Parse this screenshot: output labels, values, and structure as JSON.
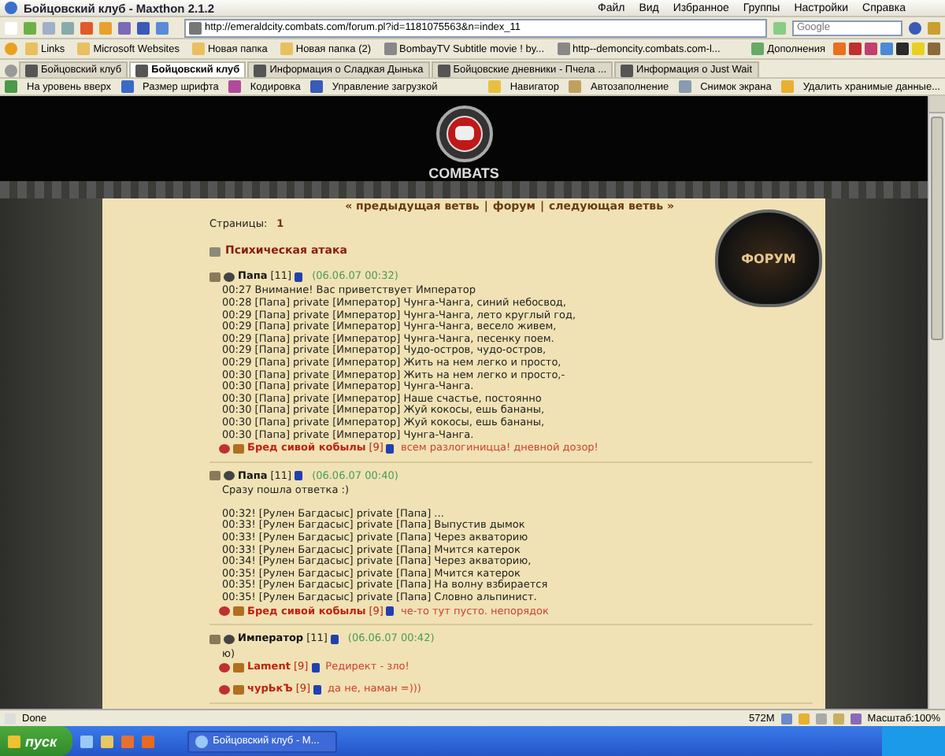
{
  "window": {
    "title": "Бойцовский клуб - Maxthon 2.1.2",
    "menu": [
      "Файл",
      "Вид",
      "Избранное",
      "Группы",
      "Настройки",
      "Справка"
    ]
  },
  "address_bar": {
    "url": "http://emeraldcity.combats.com/forum.pl?id=1181075563&n=index_11"
  },
  "search": {
    "placeholder": "Google"
  },
  "links_bar": [
    "Links",
    "Microsoft Websites",
    "Новая папка",
    "Новая папка (2)",
    "BombayTV  Subtitle movie !  by...",
    "http--demoncity.combats.com-l..."
  ],
  "plugins_button": "Дополнения",
  "tabs": [
    {
      "label": "Бойцовский клуб",
      "selected": false
    },
    {
      "label": "Бойцовский клуб",
      "selected": true
    },
    {
      "label": "Информация о Сладкая Дынька",
      "selected": false
    },
    {
      "label": "Бойцовские дневники - Пчела ...",
      "selected": false
    },
    {
      "label": "Информация о Just Wait",
      "selected": false
    }
  ],
  "tool_bar": {
    "left": [
      "На уровень вверх",
      "Размер шрифта",
      "Кодировка",
      "Управление загрузкой"
    ],
    "right": [
      "Навигатор",
      "Автозаполнение",
      "Снимок экрана",
      "Удалить хранимые данные..."
    ]
  },
  "page": {
    "logo_text": "COMBATS",
    "badge": "ФОРУМ",
    "nav": [
      "« предыдущая ветвь",
      "форум",
      "следующая ветвь »"
    ],
    "nav_separators": [
      "|",
      "|"
    ],
    "pages_label": "Страницы:",
    "pages": [
      "1"
    ],
    "thread_title": "Психическая атака",
    "posts": [
      {
        "author": "Папа",
        "rank": "[11]",
        "date": "(06.06.07 00:32)",
        "lines": [
          "00:27 Внимание! Вас приветствует Император",
          "00:28 [Папа] private [Император] Чунга-Чанга, синий небосвод,",
          "00:29 [Папа] private [Император] Чунга-Чанга, лето круглый год,",
          "00:29 [Папа] private [Император] Чунга-Чанга, весело живем,",
          "00:29 [Папа] private [Император] Чунга-Чанга, песенку поем.",
          "00:29 [Папа] private [Император] Чудо-остров, чудо-остров,",
          "00:29 [Папа] private [Император] Жить на нем легко и просто,",
          "00:30 [Папа] private [Император] Жить на нем легко и просто,-",
          "00:30 [Папа] private [Император] Чунга-Чанга.",
          "00:30 [Папа] private [Император] Наше счастье, постоянно",
          "00:30 [Папа] private [Император] Жуй кокосы, ешь бананы,",
          "00:30 [Папа] private [Император] Жуй кокосы, ешь бананы,",
          "00:30 [Папа] private [Император] Чунга-Чанга."
        ],
        "replies": [
          {
            "author": "Бред сивой кобылы",
            "rank": "[9]",
            "text": "всем разлогиниццa! дневной дозор!"
          }
        ]
      },
      {
        "author": "Папа",
        "rank": "[11]",
        "date": "(06.06.07 00:40)",
        "intro": "Сразу пошла ответка :)",
        "lines": [
          "00:32! [Рулен Багдасыс] private [Папа] ...",
          "00:33! [Рулен Багдасыс] private [Папа] Выпустив дымок",
          "00:33! [Рулен Багдасыс] private [Папа] Через акваторию",
          "00:33! [Рулен Багдасыс] private [Папа] Мчится катерок",
          "00:34! [Рулен Багдасыс] private [Папа] Через акваторию,",
          "00:35! [Рулен Багдасыс] private [Папа] Мчится катерок",
          "00:35! [Рулен Багдасыс] private [Папа] На волну взбирается",
          "00:35! [Рулен Багдасыс] private [Папа] Словно альпинист."
        ],
        "replies": [
          {
            "author": "Бред сивой кобылы",
            "rank": "[9]",
            "text": "че-то тут пусто. непорядок"
          }
        ]
      },
      {
        "author": "Император",
        "rank": "[11]",
        "date": "(06.06.07 00:42)",
        "lines": [
          "ю)"
        ],
        "replies": [
          {
            "author": "Lament",
            "rank": "[9]",
            "text": "Редирект - зло!"
          },
          {
            "author": "чурЬкЪ",
            "rank": "[9]",
            "text": "да не, наман =)))"
          }
        ]
      }
    ]
  },
  "status_bar": {
    "text": "Done",
    "memory": "572M",
    "zoom": "Масштаб:100%"
  },
  "taskbar": {
    "start": "пуск",
    "windows": [
      "Бойцовский клуб - M..."
    ]
  }
}
